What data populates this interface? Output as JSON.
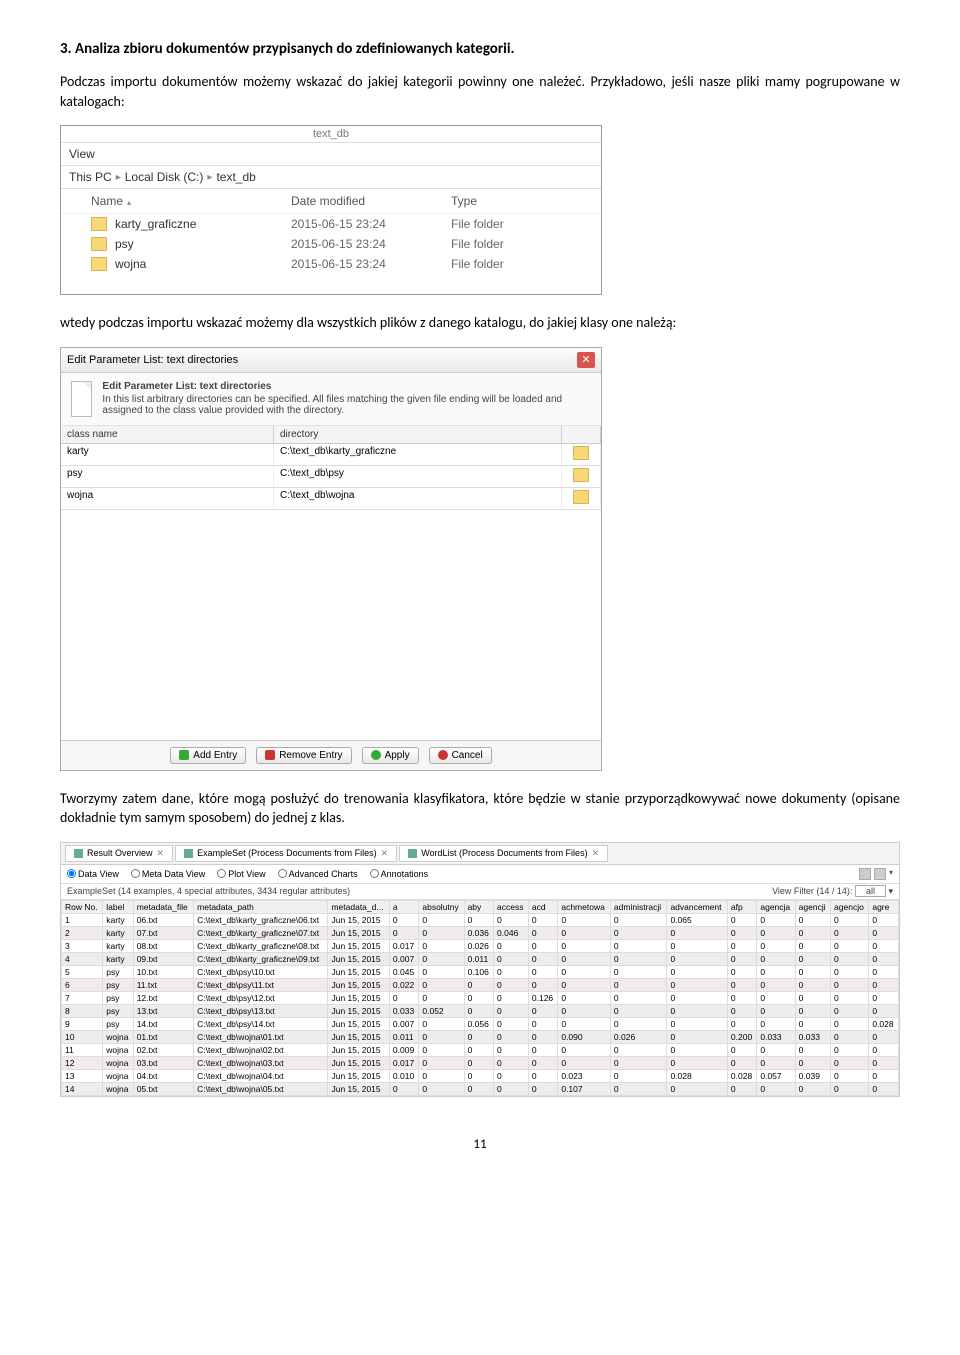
{
  "heading": "3.   Analiza zbioru dokumentów przypisanych do zdefiniowanych kategorii.",
  "para1": "Podczas importu dokumentów możemy wskazać do jakiej kategorii powinny one należeć. Przykładowo, jeśli nasze pliki mamy pogrupowane w katalogach:",
  "explorer": {
    "title": "text_db",
    "menu": "View",
    "bread": [
      "This PC",
      "Local Disk (C:)",
      "text_db"
    ],
    "cols": [
      "Name",
      "Date modified",
      "Type"
    ],
    "rows": [
      {
        "name": "karty_graficzne",
        "date": "2015-06-15 23:24",
        "type": "File folder"
      },
      {
        "name": "psy",
        "date": "2015-06-15 23:24",
        "type": "File folder"
      },
      {
        "name": "wojna",
        "date": "2015-06-15 23:24",
        "type": "File folder"
      }
    ]
  },
  "para2": "wtedy podczas importu wskazać możemy dla wszystkich plików z danego katalogu, do jakiej klasy one należą:",
  "dialog": {
    "title": "Edit Parameter List: text directories",
    "info_title": "Edit Parameter List: text directories",
    "info_desc": "In this list arbitrary directories can be specified. All files matching the given file ending will be loaded and assigned to the class value provided with the directory.",
    "gridhead": [
      "class name",
      "directory"
    ],
    "rows": [
      {
        "cls": "karty",
        "dir": "C:\\text_db\\karty_graficzne"
      },
      {
        "cls": "psy",
        "dir": "C:\\text_db\\psy"
      },
      {
        "cls": "wojna",
        "dir": "C:\\text_db\\wojna"
      }
    ],
    "btn_add": "Add Entry",
    "btn_remove": "Remove Entry",
    "btn_apply": "Apply",
    "btn_cancel": "Cancel"
  },
  "para3": "Tworzymy zatem dane, które mogą posłużyć do trenowania klasyfikatora, które będzie w stanie przyporządkowywać nowe dokumenty (opisane dokładnie tym samym sposobem) do jednej z klas.",
  "result": {
    "tabs": [
      "Result Overview",
      "ExampleSet (Process Documents from Files)",
      "WordList (Process Documents from Files)"
    ],
    "radios": [
      "Data View",
      "Meta Data View",
      "Plot View",
      "Advanced Charts",
      "Annotations"
    ],
    "meta_left": "ExampleSet (14 examples, 4 special attributes, 3434 regular attributes)",
    "filter_label": "View Filter (14 / 14):",
    "filter_value": "all",
    "cols": [
      "Row No.",
      "label",
      "metadata_file",
      "metadata_path",
      "metadata_d...",
      "a",
      "absolutny",
      "aby",
      "access",
      "acd",
      "achmetowa",
      "administracji",
      "advancement",
      "afp",
      "agencja",
      "agencji",
      "agencjo",
      "agre"
    ],
    "rows": [
      [
        "1",
        "karty",
        "06.txt",
        "C:\\text_db\\karty_graficzne\\06.txt",
        "Jun 15, 2015",
        "0",
        "0",
        "0",
        "0",
        "0",
        "0",
        "0",
        "0.065",
        "0",
        "0",
        "0",
        "0",
        "0"
      ],
      [
        "2",
        "karty",
        "07.txt",
        "C:\\text_db\\karty_graficzne\\07.txt",
        "Jun 15, 2015",
        "0",
        "0",
        "0.036",
        "0.046",
        "0",
        "0",
        "0",
        "0",
        "0",
        "0",
        "0",
        "0",
        "0"
      ],
      [
        "3",
        "karty",
        "08.txt",
        "C:\\text_db\\karty_graficzne\\08.txt",
        "Jun 15, 2015",
        "0.017",
        "0",
        "0.026",
        "0",
        "0",
        "0",
        "0",
        "0",
        "0",
        "0",
        "0",
        "0",
        "0"
      ],
      [
        "4",
        "karty",
        "09.txt",
        "C:\\text_db\\karty_graficzne\\09.txt",
        "Jun 15, 2015",
        "0.007",
        "0",
        "0.011",
        "0",
        "0",
        "0",
        "0",
        "0",
        "0",
        "0",
        "0",
        "0",
        "0"
      ],
      [
        "5",
        "psy",
        "10.txt",
        "C:\\text_db\\psy\\10.txt",
        "Jun 15, 2015",
        "0.045",
        "0",
        "0.106",
        "0",
        "0",
        "0",
        "0",
        "0",
        "0",
        "0",
        "0",
        "0",
        "0"
      ],
      [
        "6",
        "psy",
        "11.txt",
        "C:\\text_db\\psy\\11.txt",
        "Jun 15, 2015",
        "0.022",
        "0",
        "0",
        "0",
        "0",
        "0",
        "0",
        "0",
        "0",
        "0",
        "0",
        "0",
        "0"
      ],
      [
        "7",
        "psy",
        "12.txt",
        "C:\\text_db\\psy\\12.txt",
        "Jun 15, 2015",
        "0",
        "0",
        "0",
        "0",
        "0.126",
        "0",
        "0",
        "0",
        "0",
        "0",
        "0",
        "0",
        "0"
      ],
      [
        "8",
        "psy",
        "13.txt",
        "C:\\text_db\\psy\\13.txt",
        "Jun 15, 2015",
        "0.033",
        "0.052",
        "0",
        "0",
        "0",
        "0",
        "0",
        "0",
        "0",
        "0",
        "0",
        "0",
        "0"
      ],
      [
        "9",
        "psy",
        "14.txt",
        "C:\\text_db\\psy\\14.txt",
        "Jun 15, 2015",
        "0.007",
        "0",
        "0.056",
        "0",
        "0",
        "0",
        "0",
        "0",
        "0",
        "0",
        "0",
        "0",
        "0.028"
      ],
      [
        "10",
        "wojna",
        "01.txt",
        "C:\\text_db\\wojna\\01.txt",
        "Jun 15, 2015",
        "0.011",
        "0",
        "0",
        "0",
        "0",
        "0.090",
        "0.026",
        "0",
        "0.200",
        "0.033",
        "0.033",
        "0",
        "0"
      ],
      [
        "11",
        "wojna",
        "02.txt",
        "C:\\text_db\\wojna\\02.txt",
        "Jun 15, 2015",
        "0.009",
        "0",
        "0",
        "0",
        "0",
        "0",
        "0",
        "0",
        "0",
        "0",
        "0",
        "0",
        "0"
      ],
      [
        "12",
        "wojna",
        "03.txt",
        "C:\\text_db\\wojna\\03.txt",
        "Jun 15, 2015",
        "0.017",
        "0",
        "0",
        "0",
        "0",
        "0",
        "0",
        "0",
        "0",
        "0",
        "0",
        "0",
        "0"
      ],
      [
        "13",
        "wojna",
        "04.txt",
        "C:\\text_db\\wojna\\04.txt",
        "Jun 15, 2015",
        "0.010",
        "0",
        "0",
        "0",
        "0",
        "0.023",
        "0",
        "0.028",
        "0.028",
        "0.057",
        "0.039",
        "0",
        "0"
      ],
      [
        "14",
        "wojna",
        "05.txt",
        "C:\\text_db\\wojna\\05.txt",
        "Jun 15, 2015",
        "0",
        "0",
        "0",
        "0",
        "0",
        "0.107",
        "0",
        "0",
        "0",
        "0",
        "0",
        "0",
        "0"
      ]
    ]
  },
  "pagenum": "11"
}
